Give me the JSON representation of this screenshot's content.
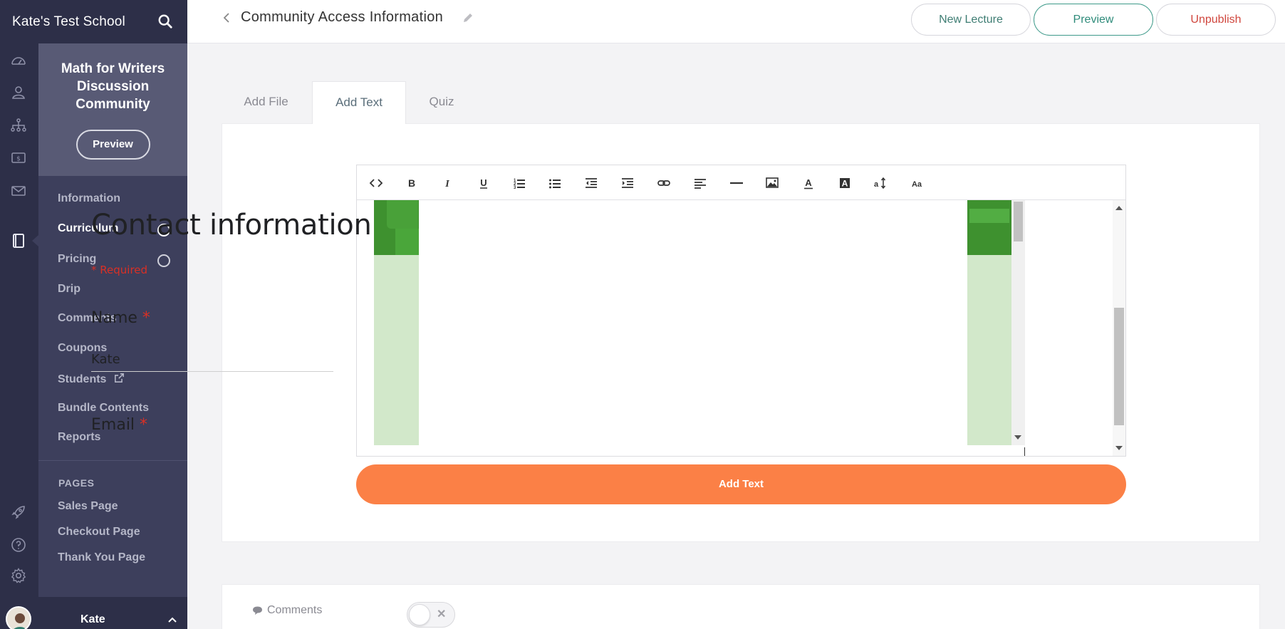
{
  "school": {
    "name": "Kate's Test School"
  },
  "course": {
    "title": "Math for Writers Discussion Community",
    "preview_label": "Preview"
  },
  "nav": {
    "items": [
      {
        "label": "Information",
        "active": false,
        "dot": false
      },
      {
        "label": "Curriculum",
        "active": true,
        "dot": true
      },
      {
        "label": "Pricing",
        "active": false,
        "dot": true
      },
      {
        "label": "Drip",
        "active": false,
        "dot": false
      },
      {
        "label": "Comments",
        "active": false,
        "dot": false
      },
      {
        "label": "Coupons",
        "active": false,
        "dot": false
      },
      {
        "label": "Students",
        "active": false,
        "dot": false,
        "external": true
      },
      {
        "label": "Bundle Contents",
        "active": false,
        "dot": false
      },
      {
        "label": "Reports",
        "active": false,
        "dot": false
      }
    ],
    "pages_heading": "PAGES",
    "pages": [
      {
        "label": "Sales Page"
      },
      {
        "label": "Checkout Page"
      },
      {
        "label": "Thank You Page"
      }
    ]
  },
  "user": {
    "name": "Kate"
  },
  "header": {
    "title": "Community Access Information",
    "buttons": {
      "new_lecture": "New Lecture",
      "preview": "Preview",
      "unpublish": "Unpublish"
    }
  },
  "tabs": [
    {
      "label": "Add File",
      "active": false
    },
    {
      "label": "Add Text",
      "active": true
    },
    {
      "label": "Quiz",
      "active": false
    }
  ],
  "editor": {
    "toolbar": [
      "code-view-icon",
      "bold-icon",
      "italic-icon",
      "underline-icon",
      "ordered-list-icon",
      "unordered-list-icon",
      "outdent-icon",
      "indent-icon",
      "link-icon",
      "align-left-icon",
      "horizontal-rule-icon",
      "image-icon",
      "text-color-icon",
      "background-color-icon",
      "line-height-icon",
      "font-size-icon"
    ],
    "embedded_form": {
      "title": "Contact information",
      "required_note": "* Required",
      "questions": [
        {
          "label": "Name",
          "required_mark": "*",
          "value": "Kate"
        },
        {
          "label": "Email",
          "required_mark": "*"
        }
      ]
    }
  },
  "submit": {
    "label": "Add Text"
  },
  "comments": {
    "label": "Comments",
    "enabled": false
  },
  "colors": {
    "sidebar_dark": "#2d2f48",
    "sidebar_panel": "#3d3f5c",
    "accent_orange": "#fb8046",
    "teal": "#2e8b7a",
    "danger": "#d0463d"
  }
}
